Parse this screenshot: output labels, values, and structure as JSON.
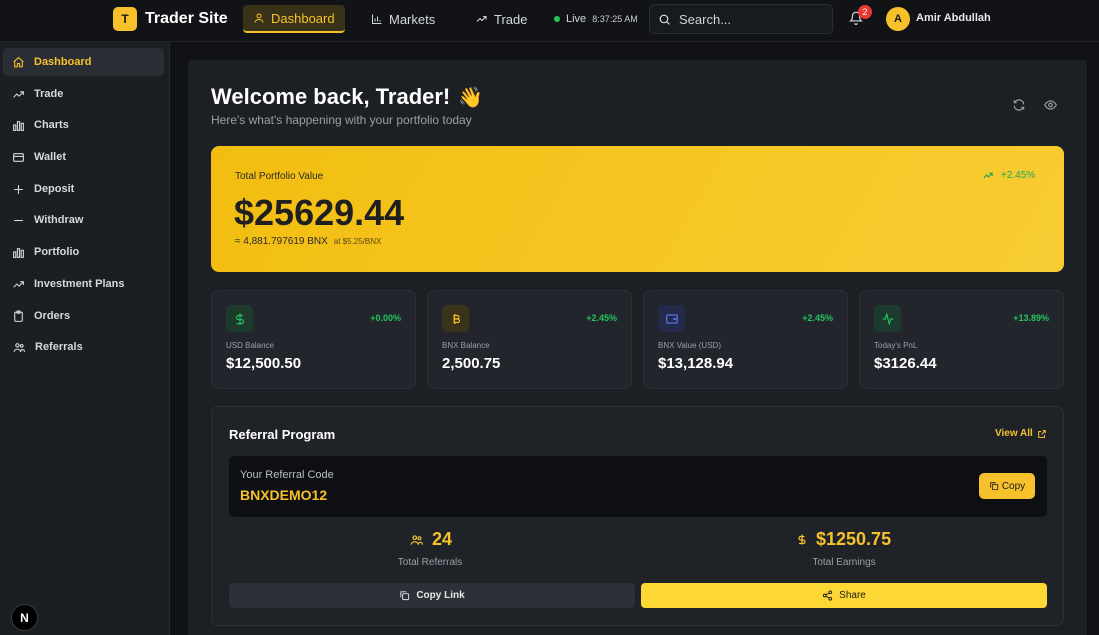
{
  "brand": {
    "logo_letter": "T",
    "name": "Trader Site"
  },
  "nav": {
    "dashboard": "Dashboard",
    "markets": "Markets",
    "trade": "Trade",
    "live_label": "Live",
    "live_time": "8:37:25 AM"
  },
  "search": {
    "placeholder": "Search..."
  },
  "notifications": {
    "count": "2"
  },
  "user": {
    "initial": "A",
    "name": "Amir Abdullah"
  },
  "sidebar": {
    "items": [
      {
        "label": "Dashboard",
        "icon": "home-icon",
        "active": true
      },
      {
        "label": "Trade",
        "icon": "trend-up-icon"
      },
      {
        "label": "Charts",
        "icon": "bar-chart-icon"
      },
      {
        "label": "Wallet",
        "icon": "wallet-icon"
      },
      {
        "label": "Deposit",
        "icon": "plus-icon"
      },
      {
        "label": "Withdraw",
        "icon": "minus-icon"
      },
      {
        "label": "Portfolio",
        "icon": "bar-chart-icon"
      },
      {
        "label": "Investment Plans",
        "icon": "trend-up-icon"
      },
      {
        "label": "Orders",
        "icon": "clipboard-icon"
      },
      {
        "label": "Referrals",
        "icon": "users-icon"
      }
    ]
  },
  "next_badge": "N",
  "header": {
    "welcome": "Welcome back, Trader!",
    "wave": "👋",
    "subtitle": "Here's what's happening with your portfolio today"
  },
  "portfolio": {
    "label": "Total Portfolio Value",
    "value": "$25629.44",
    "bnx_equiv": "≈ 4,881.797619 BNX",
    "rate": "at $5.25/BNX",
    "change": "+2.45%"
  },
  "stats": [
    {
      "label": "USD Balance",
      "value": "$12,500.50",
      "change": "+0.00%",
      "icon": "dollar-icon"
    },
    {
      "label": "BNX Balance",
      "value": "2,500.75",
      "change": "+2.45%",
      "icon": "bitcoin-icon"
    },
    {
      "label": "BNX Value (USD)",
      "value": "$13,128.94",
      "change": "+2.45%",
      "icon": "wallet-icon"
    },
    {
      "label": "Today's PnL",
      "value": "$3126.44",
      "change": "+13.89%",
      "icon": "activity-icon"
    }
  ],
  "referral": {
    "title": "Referral Program",
    "view_all": "View All",
    "code_label": "Your Referral Code",
    "code": "BNXDEMO12",
    "copy": "Copy",
    "total_referrals": "24",
    "total_referrals_label": "Total Referrals",
    "total_earnings": "$1250.75",
    "total_earnings_label": "Total Earnings",
    "copy_link": "Copy Link",
    "share": "Share"
  },
  "colors": {
    "accent": "#f6c12b",
    "positive": "#22c55e",
    "background": "#0f1115"
  }
}
